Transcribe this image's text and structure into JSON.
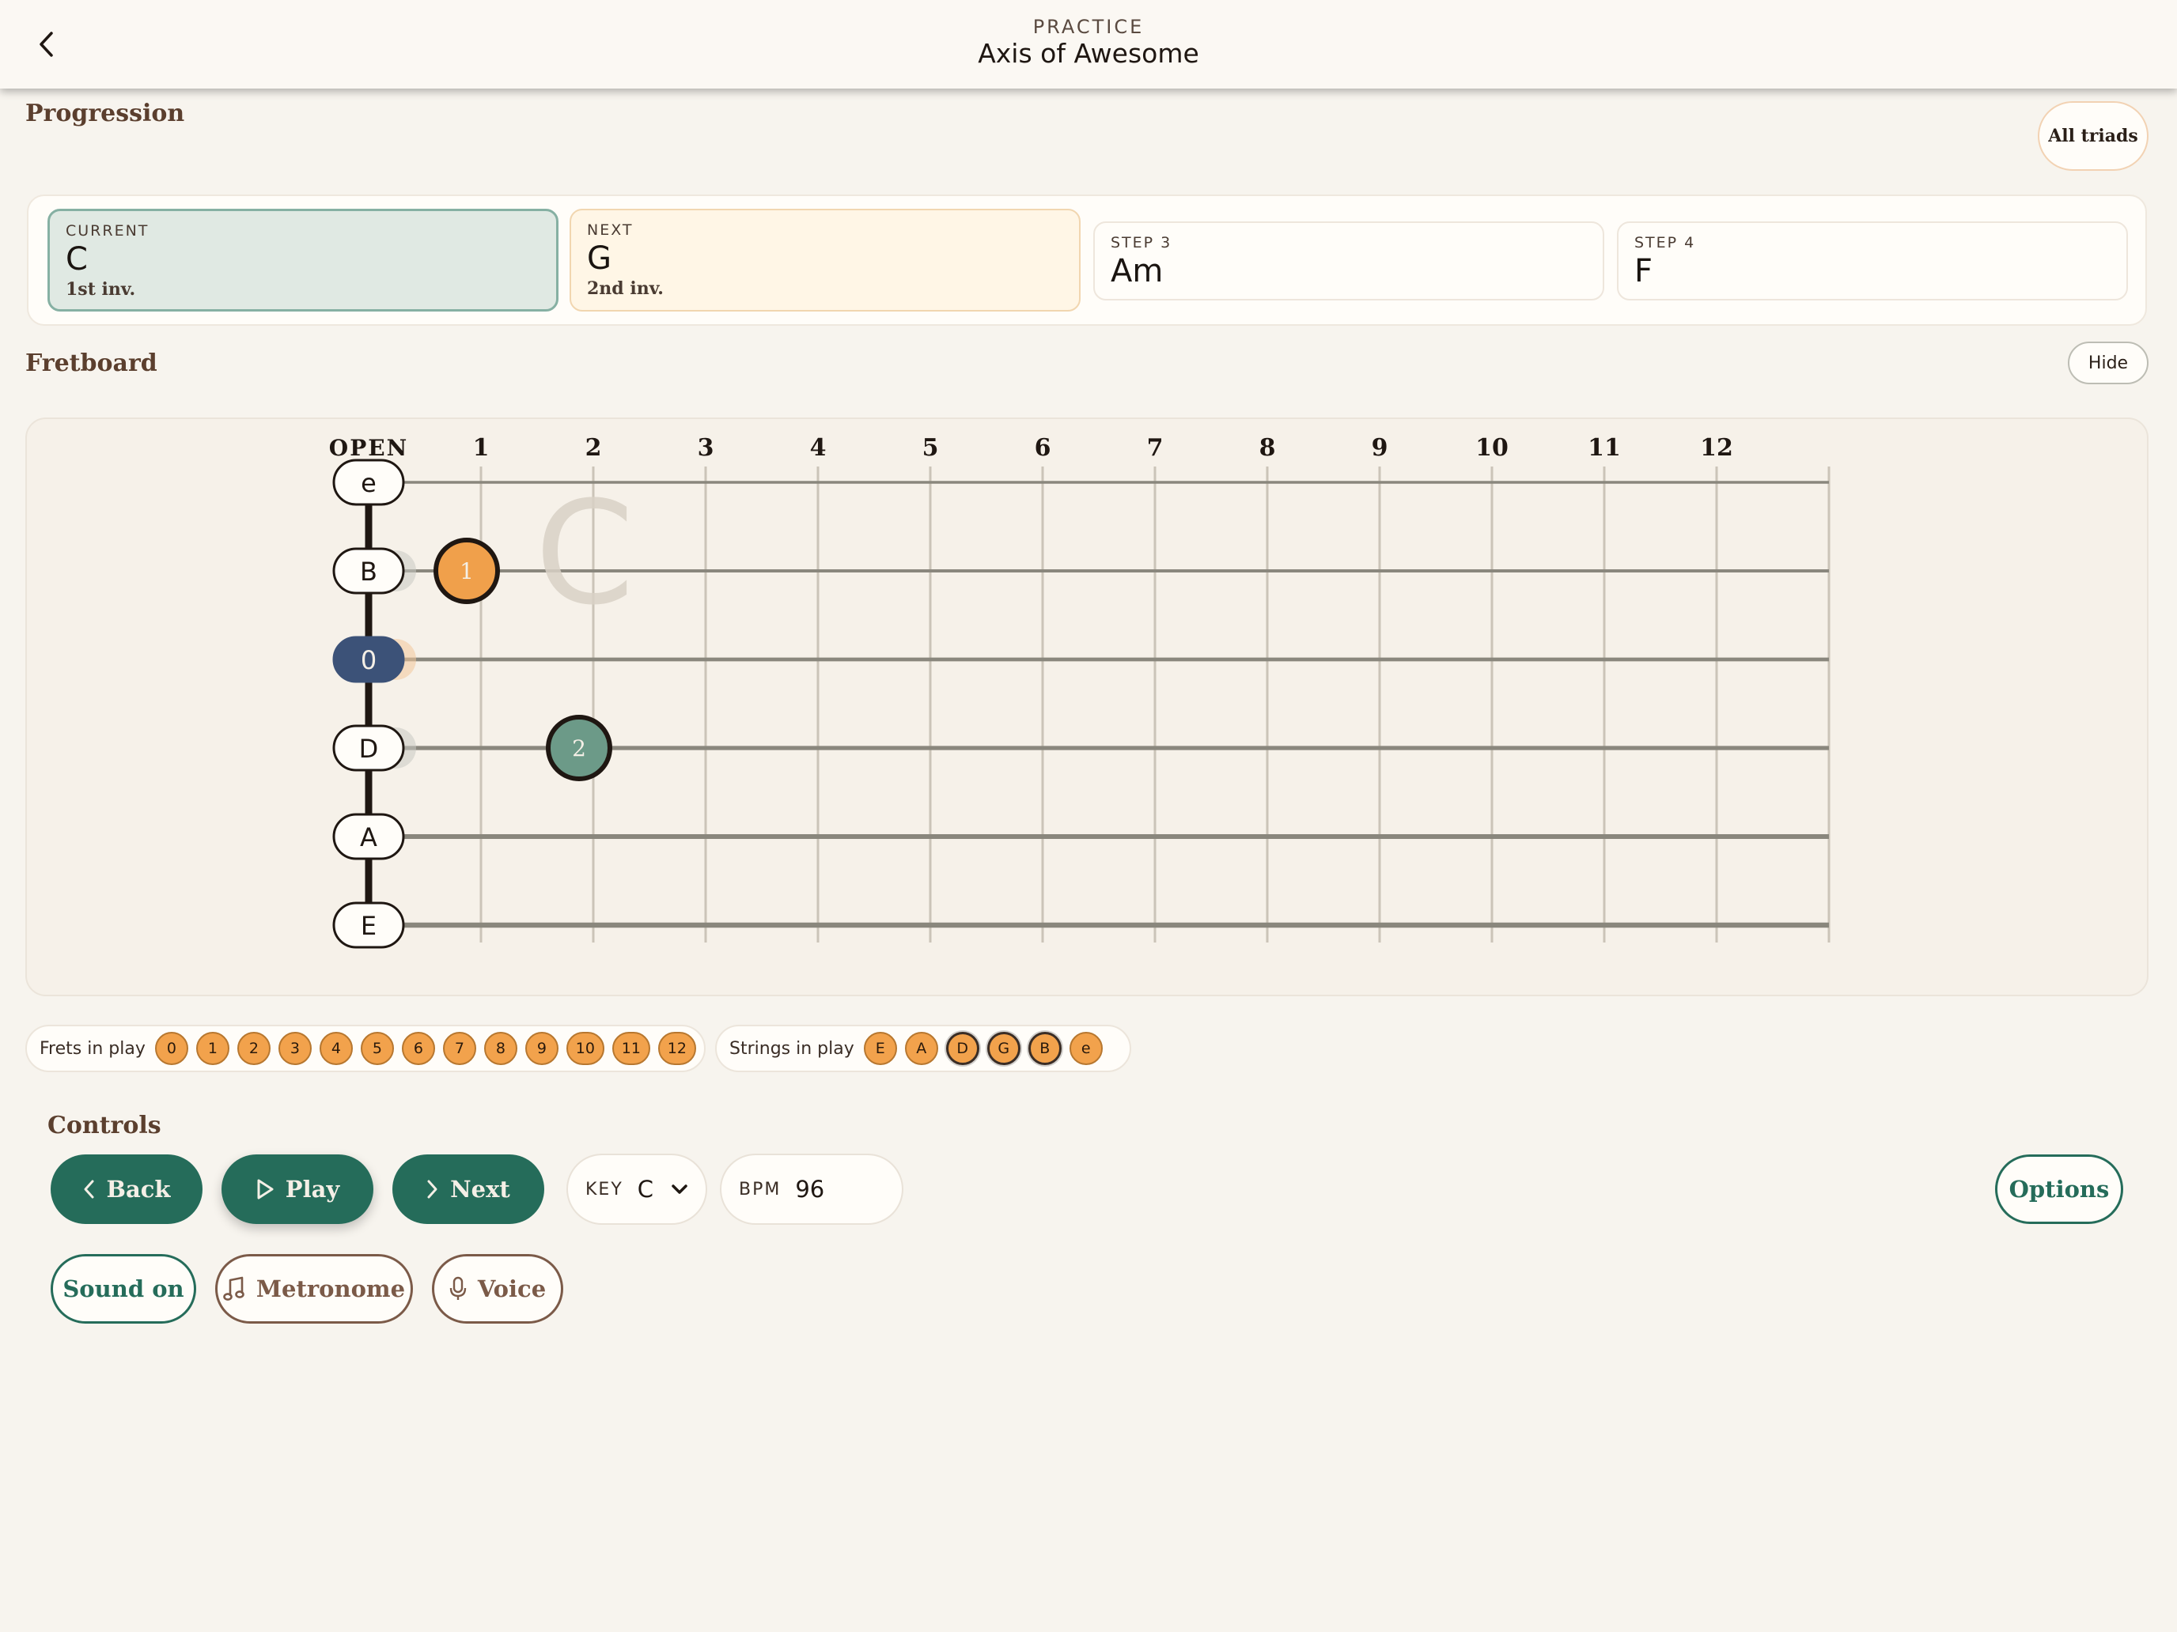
{
  "header": {
    "subtitle": "PRACTICE",
    "title": "Axis of Awesome"
  },
  "progression": {
    "title": "Progression",
    "all_triads_label": "All triads",
    "cards": [
      {
        "label": "CURRENT",
        "chord": "C",
        "inversion": "1st inv."
      },
      {
        "label": "NEXT",
        "chord": "G",
        "inversion": "2nd inv."
      },
      {
        "label": "STEP 3",
        "chord": "Am",
        "inversion": ""
      },
      {
        "label": "STEP 4",
        "chord": "F",
        "inversion": ""
      }
    ]
  },
  "fretboard": {
    "title": "Fretboard",
    "hide_label": "Hide",
    "fret_labels": [
      "OPEN",
      "1",
      "2",
      "3",
      "4",
      "5",
      "6",
      "7",
      "8",
      "9",
      "10",
      "11",
      "12"
    ],
    "strings": [
      "e",
      "B",
      "0",
      "D",
      "A",
      "E"
    ],
    "watermark_chord": "C",
    "notes": [
      {
        "string_index": 1,
        "fret": 1,
        "label": "1",
        "color": "#f0a04b"
      },
      {
        "string_index": 3,
        "fret": 2,
        "label": "2",
        "color": "#6c9a88"
      }
    ],
    "open_highlight": {
      "string_index": 2,
      "color": "#3c5278"
    }
  },
  "frets_in_play": {
    "label": "Frets in play",
    "items": [
      "0",
      "1",
      "2",
      "3",
      "4",
      "5",
      "6",
      "7",
      "8",
      "9",
      "10",
      "11",
      "12"
    ]
  },
  "strings_in_play": {
    "label": "Strings in play",
    "items": [
      "E",
      "A",
      "D",
      "G",
      "B",
      "e"
    ],
    "selected": [
      "D",
      "G",
      "B"
    ]
  },
  "controls": {
    "title": "Controls",
    "back_label": "Back",
    "play_label": "Play",
    "next_label": "Next",
    "key_label": "KEY",
    "key_value": "C",
    "bpm_label": "BPM",
    "bpm_value": "96",
    "options_label": "Options",
    "sound_label": "Sound on",
    "metronome_label": "Metronome",
    "voice_label": "Voice"
  },
  "colors": {
    "accent_green": "#256c5a",
    "chip_orange": "#f2a24c",
    "current_card_bg": "#e0e9e3",
    "next_card_bg": "#fff6e6"
  }
}
